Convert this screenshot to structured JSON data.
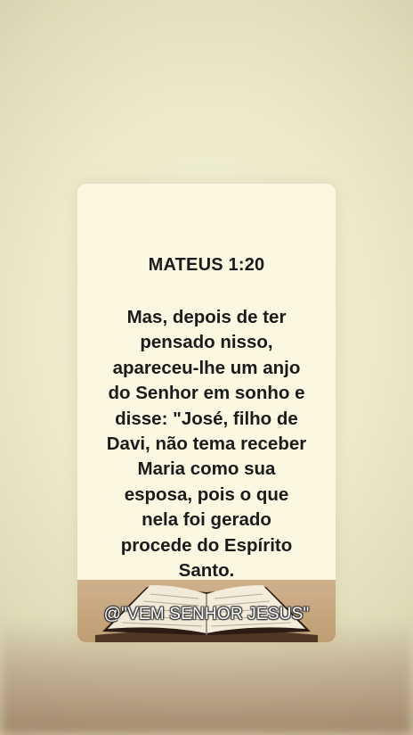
{
  "card": {
    "reference": "MATEUS 1:20",
    "verse_lines": [
      "Mas, depois de ter",
      "pensado nisso,",
      "apareceu-lhe um anjo",
      "do Senhor em sonho e",
      "disse: \"José, filho de",
      "Davi, não tema receber",
      "Maria como sua",
      "esposa, pois o que",
      "nela foi gerado",
      "procede do Espírito",
      "Santo."
    ],
    "watermark": "@\"VEM SENHOR JESUS\""
  },
  "colors": {
    "background": "#eceac9",
    "card": "#fbf7e1",
    "text": "#1b1b1b"
  }
}
